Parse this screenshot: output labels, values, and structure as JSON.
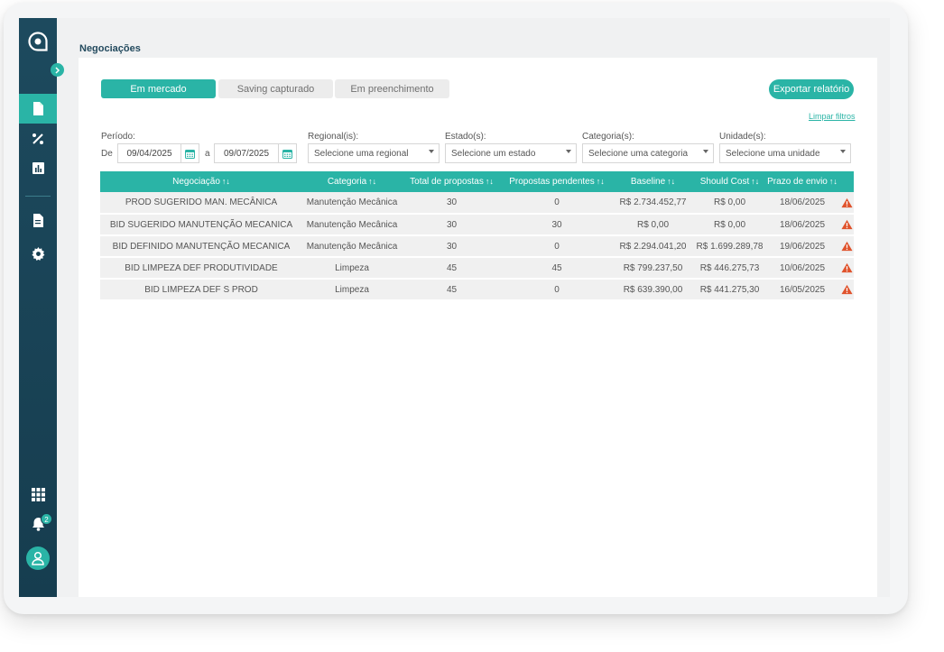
{
  "app": {
    "page_title": "Negociações",
    "notification_count": "2"
  },
  "tabs": [
    {
      "label": "Em mercado",
      "active": true
    },
    {
      "label": "Saving capturado",
      "active": false
    },
    {
      "label": "Em preenchimento",
      "active": false
    }
  ],
  "actions": {
    "export_label": "Exportar relatório",
    "clear_filters_label": "Limpar filtros"
  },
  "filters": {
    "period_label": "Período:",
    "from_label": "De",
    "to_label": "a",
    "date_from": "09/04/2025",
    "date_to": "09/07/2025",
    "regional_label": "Regional(is):",
    "regional_placeholder": "Selecione uma regional",
    "state_label": "Estado(s):",
    "state_placeholder": "Selecione um estado",
    "category_label": "Categoria(s):",
    "category_placeholder": "Selecione uma categoria",
    "unit_label": "Unidade(s):",
    "unit_placeholder": "Selecione uma unidade"
  },
  "table": {
    "sort_icon": "↑↓",
    "columns": [
      "Negociação",
      "Categoria",
      "Total de propostas",
      "Propostas pendentes",
      "Baseline",
      "Should Cost",
      "Prazo de envio"
    ],
    "rows": [
      [
        "PROD SUGERIDO MAN. MECÂNICA",
        "Manutenção Mecânica",
        "30",
        "0",
        "R$ 2.734.452,77",
        "R$ 0,00",
        "18/06/2025"
      ],
      [
        "BID SUGERIDO MANUTENÇÃO MECANICA",
        "Manutenção Mecânica",
        "30",
        "30",
        "R$ 0,00",
        "R$ 0,00",
        "18/06/2025"
      ],
      [
        "BID DEFINIDO MANUTENÇÃO MECANICA",
        "Manutenção Mecânica",
        "30",
        "0",
        "R$ 2.294.041,20",
        "R$ 1.699.289,78",
        "19/06/2025"
      ],
      [
        "BID LIMPEZA DEF PRODUTIVIDADE",
        "Limpeza",
        "45",
        "45",
        "R$ 799.237,50",
        "R$ 446.275,73",
        "10/06/2025"
      ],
      [
        "BID LIMPEZA DEF S PROD",
        "Limpeza",
        "45",
        "0",
        "R$ 639.390,00",
        "R$ 441.275,30",
        "16/05/2025"
      ]
    ],
    "row_status_icon": "warning-icon"
  },
  "colors": {
    "accent": "#2ab4a6",
    "sidebar": "#1d4a5e",
    "warning": "#e0532c"
  }
}
